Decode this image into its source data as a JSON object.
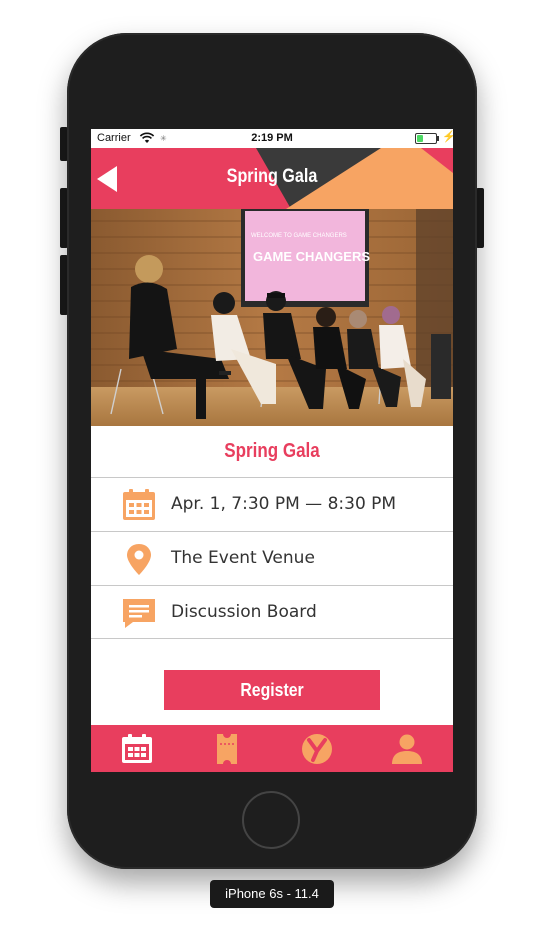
{
  "status_bar": {
    "carrier": "Carrier",
    "time": "2:19 PM"
  },
  "nav": {
    "title": "Spring Gala",
    "back_icon": "back-triangle-icon"
  },
  "hero_photo": {
    "screen_text": "WELCOME TO GAME CHANGERS",
    "screen_text_title": "GAME CHANGERS"
  },
  "event": {
    "title": "Spring Gala",
    "details": [
      {
        "icon": "calendar-icon",
        "label": "Apr. 1, 7:30 PM — 8:30 PM"
      },
      {
        "icon": "location-pin-icon",
        "label": "The Event Venue"
      },
      {
        "icon": "chat-bubble-icon",
        "label": "Discussion Board"
      }
    ]
  },
  "register_label": "Register",
  "tab_bar": [
    {
      "icon": "calendar-icon",
      "active": true
    },
    {
      "icon": "ticket-icon",
      "active": false
    },
    {
      "icon": "y-logo-icon",
      "active": false
    },
    {
      "icon": "person-icon",
      "active": false
    }
  ],
  "device_label": "iPhone 6s - 11.4",
  "colors": {
    "brand": "#e83e5e",
    "accent": "#f7a463",
    "dark": "#3a3a3a",
    "tab_inactive": "#f7a463",
    "tab_active": "#ffffff"
  }
}
